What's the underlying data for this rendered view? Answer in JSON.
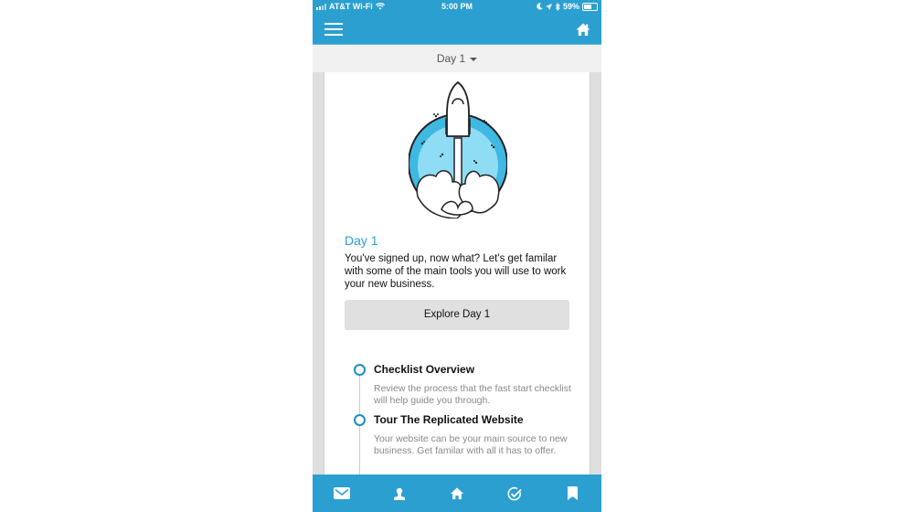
{
  "status_bar": {
    "carrier": "AT&T Wi-Fi",
    "time": "5:00 PM",
    "battery": "59%",
    "icons": [
      "signal-icon",
      "wifi-icon",
      "moon-icon",
      "location-icon",
      "bluetooth-icon",
      "battery-icon"
    ]
  },
  "nav": {
    "menu_icon": "hamburger-icon",
    "home_icon": "home-icon"
  },
  "day_selector": {
    "selected": "Day 1"
  },
  "card": {
    "illustration": "rocket-launch-illustration",
    "title": "Day 1",
    "description": "You've signed up, now what?  Let's get familar with some of the main tools you will use to work your new business.",
    "button_label": "Explore Day 1"
  },
  "timeline": [
    {
      "title": "Checklist Overview",
      "description": "Review the process that the fast start checklist will help guide you through."
    },
    {
      "title": "Tour The Replicated Website",
      "description": "Your website can be your main source to new business.  Get familar with all it has to offer."
    }
  ],
  "tab_bar": [
    {
      "icon": "mail-icon"
    },
    {
      "icon": "profile-icon"
    },
    {
      "icon": "home-icon"
    },
    {
      "icon": "checklist-icon"
    },
    {
      "icon": "bookmark-icon"
    }
  ],
  "colors": {
    "brand": "#2a9fd0",
    "timeline_dot": "#1d8fc6",
    "rocket_fin": "#e8623c",
    "sky": "#4fc3e8"
  }
}
